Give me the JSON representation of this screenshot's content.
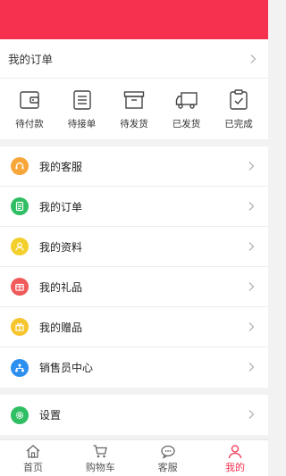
{
  "colors": {
    "brand": "#f5314f",
    "service": "#f7a63a",
    "orders": "#2fbe63",
    "profile": "#f3cf2c",
    "gifts": "#f05a5a",
    "giveaways": "#f6c52e",
    "sales": "#2d8fef",
    "settings": "#2fbe63"
  },
  "orders": {
    "title": "我的订单",
    "statuses": [
      {
        "label": "待付款",
        "icon": "wallet-icon"
      },
      {
        "label": "待接单",
        "icon": "list-doc-icon"
      },
      {
        "label": "待发货",
        "icon": "box-icon"
      },
      {
        "label": "已发货",
        "icon": "truck-icon"
      },
      {
        "label": "已完成",
        "icon": "clipboard-check-icon"
      }
    ]
  },
  "menu": [
    {
      "label": "我的客服",
      "icon": "headset-icon",
      "color": "#f7a63a"
    },
    {
      "label": "我的订单",
      "icon": "document-icon",
      "color": "#2fbe63"
    },
    {
      "label": "我的资料",
      "icon": "person-icon",
      "color": "#f3cf2c"
    },
    {
      "label": "我的礼品",
      "icon": "gift-icon",
      "color": "#f05a5a"
    },
    {
      "label": "我的赠品",
      "icon": "present-icon",
      "color": "#f6c52e"
    },
    {
      "label": "销售员中心",
      "icon": "network-icon",
      "color": "#2d8fef"
    }
  ],
  "settings": {
    "label": "设置",
    "icon": "gear-icon",
    "color": "#2fbe63"
  },
  "tabbar": [
    {
      "label": "首页",
      "icon": "home-icon",
      "active": false
    },
    {
      "label": "购物车",
      "icon": "cart-icon",
      "active": false
    },
    {
      "label": "客服",
      "icon": "chat-icon",
      "active": false
    },
    {
      "label": "我的",
      "icon": "user-icon",
      "active": true
    }
  ]
}
